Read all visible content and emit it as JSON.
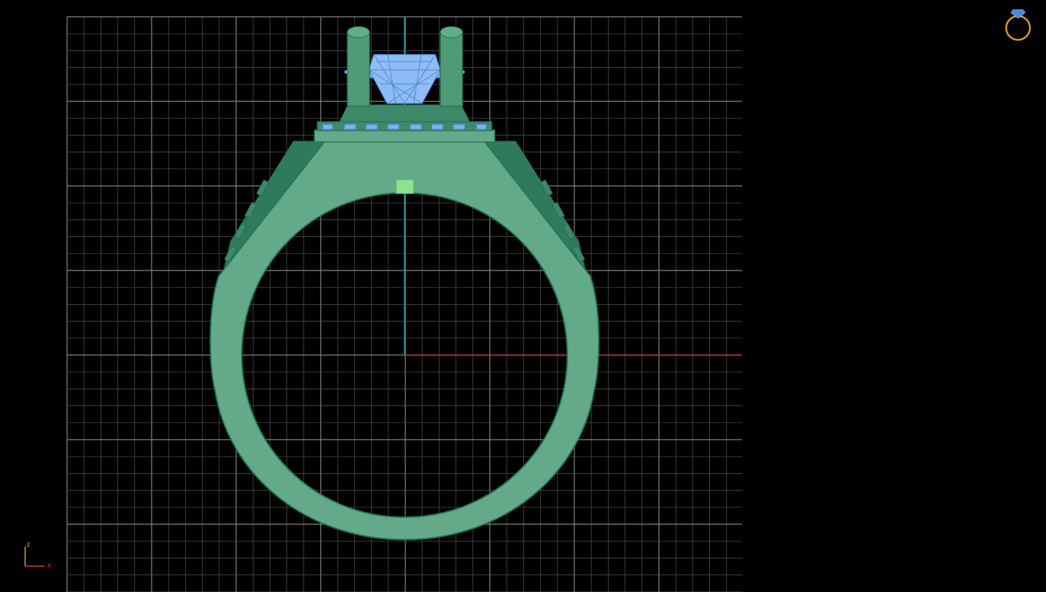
{
  "viewport": {
    "background": "#000000",
    "grid_color": "#5a5a5a",
    "grid_major_color": "#8a8a8a",
    "x_axis_color": "#c0392b",
    "z_axis_color": "#1aa3a3"
  },
  "model": {
    "shank_color": "#63a98a",
    "shank_edge_color": "#1f7a55",
    "shank_dark_color": "#2f7a5c",
    "gem_color": "#7fb2f0",
    "gem_wire_color": "#4a86e0",
    "selection_marker_color": "#8fe08f"
  },
  "axis_indicator": {
    "z_label": "z",
    "x_label": "x",
    "z_color": "#d9a441",
    "x_color": "#d9413a"
  },
  "corner_icon": {
    "name": "ring-icon",
    "color": "#e0a020"
  }
}
